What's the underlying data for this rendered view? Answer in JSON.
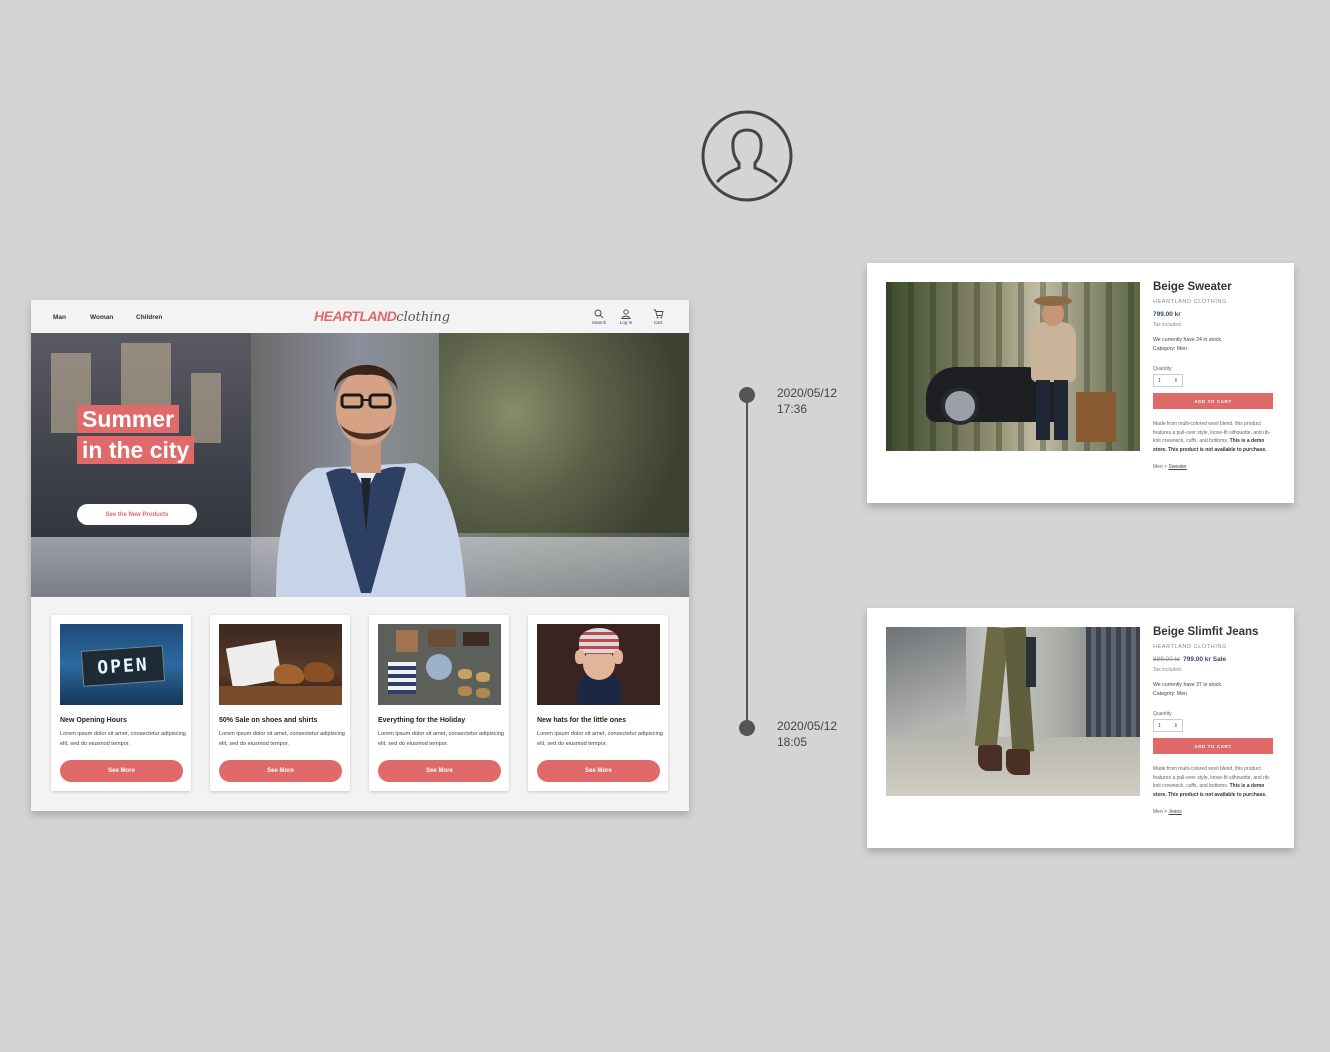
{
  "store": {
    "nav": {
      "links": [
        "Man",
        "Woman",
        "Children"
      ],
      "logo_brand": "Heartland",
      "logo_suffix": "clothing",
      "icons": [
        {
          "icon": "search-icon",
          "label": "Search"
        },
        {
          "icon": "user-icon",
          "label": "Log In"
        },
        {
          "icon": "cart-icon",
          "label": "Cart"
        }
      ]
    },
    "hero": {
      "title_line1": "Summer",
      "title_line2": "in the city",
      "button_label": "See the New Products"
    },
    "cards": [
      {
        "image": "open-sign-image",
        "title": "New Opening Hours",
        "text": "Lorem ipsum dolor sit amet, consectetur adipiscing elit, sed do eiusmod tempor.",
        "button": "See More",
        "sign": "OPEN"
      },
      {
        "image": "shoes-shirts-image",
        "title": "50% Sale on shoes and shirts",
        "text": "Lorem ipsum dolor sit amet, consectetur adipiscing elit, sed do eiusmod tempor.",
        "button": "See More"
      },
      {
        "image": "holiday-flatlay-image",
        "title": "Everything for the Holiday",
        "text": "Lorem ipsum dolor sit amet, consectetur adipiscing elit, sed do eiusmod tempor.",
        "button": "See More"
      },
      {
        "image": "child-hat-image",
        "title": "New hats for the little ones",
        "text": "Lorem ipsum dolor sit amet, consectetur adipiscing elit, sed do eiusmod tempor.",
        "button": "See More"
      }
    ]
  },
  "timeline": [
    {
      "date": "2020/05/12",
      "time": "17:36"
    },
    {
      "date": "2020/05/12",
      "time": "18:05"
    }
  ],
  "products": [
    {
      "name": "Beige Sweater",
      "brand": "Heartland Clothing",
      "price": "799.00 kr",
      "old_price": "",
      "sale_price": "",
      "tax": "Tax included.",
      "stock": "We currently have 24 in stock.",
      "category": "Category: Men",
      "quantity_label": "Quantity",
      "quantity": "1",
      "cart_label": "ADD TO CART",
      "desc": "Made from multi-colored wool blend, this product features a pull-over style, loose-fit silhouette, and rib-knit crewneck, cuffs, and bottoms.",
      "demo_note": "This is a demo store. This product is not available to purchase.",
      "crumb_root": "Men >",
      "crumb_leaf": "Sweater"
    },
    {
      "name": "Beige Slimfit Jeans",
      "brand": "Heartland Clothing",
      "price": "",
      "old_price": "899.00 kr",
      "sale_price": "799.00 kr Sale",
      "tax": "Tax included.",
      "stock": "We currently have 37 in stock.",
      "category": "Category: Men",
      "quantity_label": "Quantity",
      "quantity": "1",
      "cart_label": "ADD TO CART",
      "desc": "Made from multi-colored wool blend, this product features a pull-over style, loose-fit silhouette, and rib-knit crewneck, cuffs, and bottoms.",
      "demo_note": "This is a demo store. This product is not available to purchase.",
      "crumb_root": "Men >",
      "crumb_leaf": "Jeans"
    }
  ],
  "colors": {
    "accent": "#e06a6a",
    "background": "#d4d4d4",
    "timeline": "#555555",
    "price": "#3b4a6b"
  }
}
